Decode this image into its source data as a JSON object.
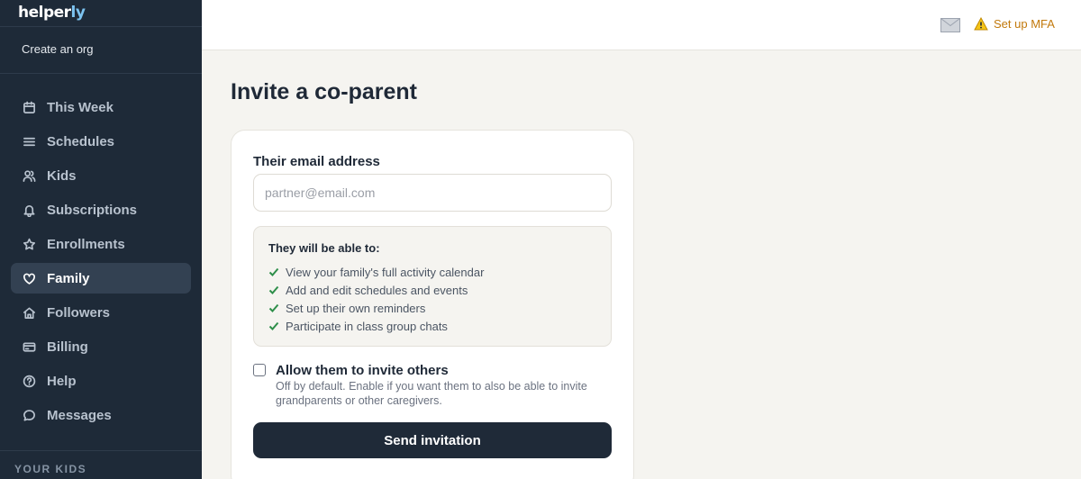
{
  "brand": {
    "name_main": "helper",
    "name_accent": "ly"
  },
  "org_link": "Create an org",
  "nav": [
    {
      "label": "This Week",
      "icon": "calendar-icon",
      "active": false
    },
    {
      "label": "Schedules",
      "icon": "list-icon",
      "active": false
    },
    {
      "label": "Kids",
      "icon": "users-icon",
      "active": false
    },
    {
      "label": "Subscriptions",
      "icon": "bell-icon",
      "active": false
    },
    {
      "label": "Enrollments",
      "icon": "star-icon",
      "active": false
    },
    {
      "label": "Family",
      "icon": "heart-icon",
      "active": true
    },
    {
      "label": "Followers",
      "icon": "home-icon",
      "active": false
    },
    {
      "label": "Billing",
      "icon": "credit-card-icon",
      "active": false
    },
    {
      "label": "Help",
      "icon": "help-circle-icon",
      "active": false
    },
    {
      "label": "Messages",
      "icon": "chat-bubble-icon",
      "active": false
    }
  ],
  "sidebar_section": "YOUR KIDS",
  "topbar": {
    "mail_icon": "mail-icon",
    "mfa_label": "Set up MFA",
    "mfa_icon": "warning-icon"
  },
  "page": {
    "title": "Invite a co-parent"
  },
  "form": {
    "email_label": "Their email address",
    "email_placeholder": "partner@email.com",
    "email_value": "",
    "permissions_title": "They will be able to:",
    "permissions": [
      "View your family's full activity calendar",
      "Add and edit schedules and events",
      "Set up their own reminders",
      "Participate in class group chats"
    ],
    "allow_invite_label": "Allow them to invite others",
    "allow_invite_checked": false,
    "allow_invite_help": "Off by default. Enable if you want them to also be able to invite grandparents or other caregivers.",
    "submit_label": "Send invitation"
  },
  "colors": {
    "sidebar_bg": "#1e2a38",
    "sidebar_active_bg": "#334152",
    "page_bg": "#f5f4f0",
    "warning": "#c2790c",
    "check": "#2e8f4a",
    "button_bg": "#1f2a38"
  }
}
